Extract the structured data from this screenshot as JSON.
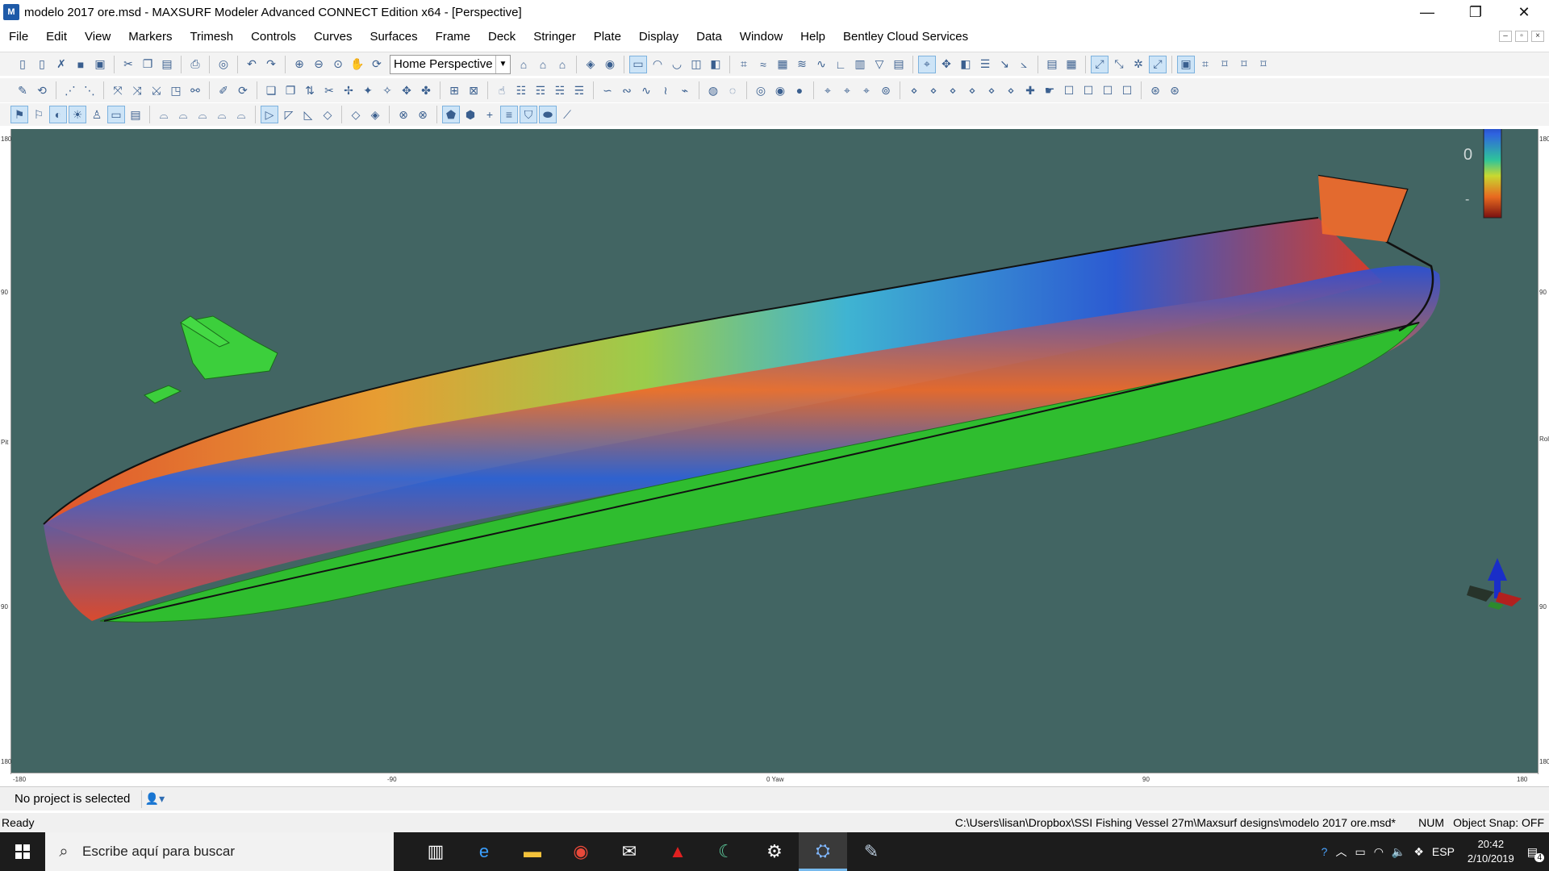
{
  "window": {
    "title": "modelo 2017 ore.msd - MAXSURF Modeler Advanced CONNECT Edition x64 - [Perspective]",
    "app_icon": "maxsurf-icon",
    "controls": {
      "minimize": "—",
      "restore": "❐",
      "close": "✕"
    }
  },
  "menu": [
    "File",
    "Edit",
    "View",
    "Markers",
    "Trimesh",
    "Controls",
    "Curves",
    "Surfaces",
    "Frame",
    "Deck",
    "Stringer",
    "Plate",
    "Display",
    "Data",
    "Window",
    "Help",
    "Bentley Cloud Services"
  ],
  "toolbar": {
    "view_select": "Home Perspective"
  },
  "viewport": {
    "background": "#426563",
    "ruler_ticks": {
      "left_top": "180",
      "left_mid": "90",
      "left_center": "Pit",
      "left_low": "90",
      "left_bottom": "180",
      "bottom_left": "-180",
      "bottom_q1": "-90",
      "bottom_center": "0 Yaw",
      "bottom_q3": "90",
      "bottom_right": "180",
      "right_center": "Roll"
    },
    "colorbar": {
      "top": "+",
      "mid": "0",
      "bottom": "-"
    }
  },
  "project": {
    "label": "No project is selected"
  },
  "status": {
    "ready": "Ready",
    "path": "C:\\Users\\lisan\\Dropbox\\SSI Fishing Vessel 27m\\Maxsurf designs\\modelo 2017 ore.msd*",
    "num": "NUM",
    "snap": "Object Snap: OFF"
  },
  "taskbar": {
    "search_placeholder": "Escribe aquí para buscar",
    "lang": "ESP",
    "time": "20:42",
    "date": "2/10/2019",
    "notifications": "4"
  }
}
